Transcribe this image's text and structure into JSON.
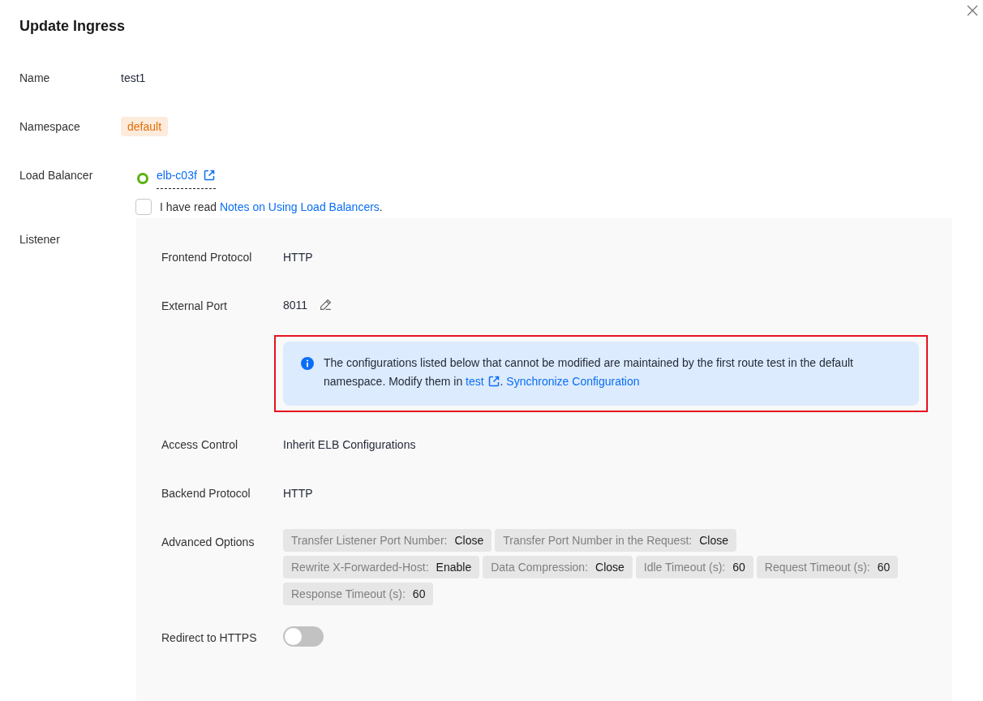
{
  "dialog": {
    "title": "Update Ingress"
  },
  "name": {
    "label": "Name",
    "value": "test1"
  },
  "namespace": {
    "label": "Namespace",
    "value": "default"
  },
  "load_balancer": {
    "label": "Load Balancer",
    "value": "elb-c03f",
    "agreement": {
      "checked": false,
      "text": "I have read ",
      "link": "Notes on Using Load Balancers",
      "suffix": "."
    }
  },
  "listener": {
    "label": "Listener",
    "rows": [
      {
        "kind": "text",
        "label": "Frontend Protocol",
        "value": "HTTP"
      },
      {
        "kind": "editable",
        "label": "External Port",
        "value": "8011"
      },
      {
        "kind": "notice",
        "text": "The configurations listed below that cannot be modified are maintained by the first route test in the default namespace. Modify them in ",
        "link": "test",
        "separator": ". ",
        "action": "Synchronize Configuration"
      },
      {
        "kind": "text",
        "label": "Access Control",
        "value": "Inherit ELB Configurations"
      },
      {
        "kind": "text",
        "label": "Backend Protocol",
        "value": "HTTP"
      },
      {
        "kind": "tags",
        "label": "Advanced Options",
        "tags": [
          {
            "name": "Transfer Listener Port Number:",
            "value": "Close"
          },
          {
            "name": "Transfer Port Number in the Request:",
            "value": "Close"
          },
          {
            "name": "Rewrite X-Forwarded-Host:",
            "value": "Enable"
          },
          {
            "name": "Data Compression:",
            "value": "Close"
          },
          {
            "name": "Idle Timeout (s):",
            "value": "60"
          },
          {
            "name": "Request Timeout (s):",
            "value": "60"
          },
          {
            "name": "Response Timeout (s):",
            "value": "60"
          }
        ]
      },
      {
        "kind": "switch",
        "label": "Redirect to HTTPS",
        "on": false
      }
    ]
  }
}
